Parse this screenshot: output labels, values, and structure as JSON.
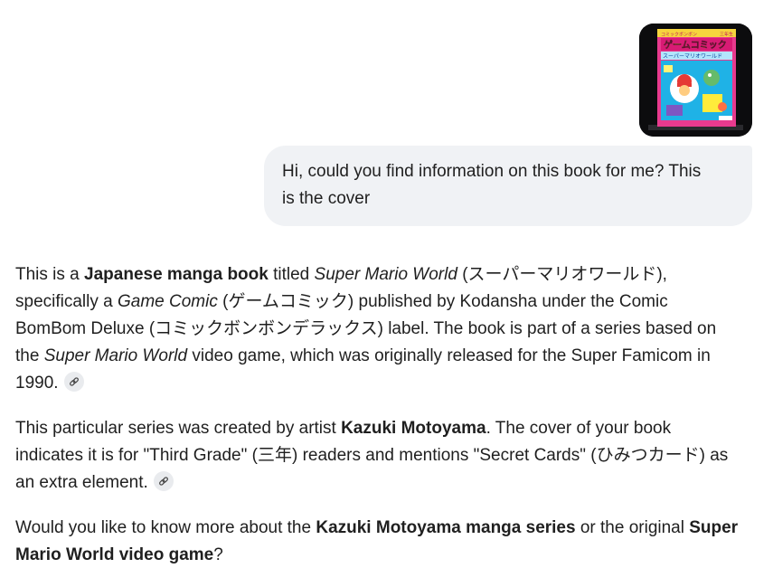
{
  "user_message": {
    "attachment_alt": "Book cover",
    "cover_text": {
      "series": "ゲームコミック",
      "subtitle": "スーパーマリオワールド",
      "top_small": "三年生",
      "label": "コミックボンボン"
    },
    "text_line1": "Hi, could you find information on this book for me? This",
    "text_line2": "is the cover"
  },
  "response": {
    "p1": {
      "t1": "This is a ",
      "b1": "Japanese manga book",
      "t2": " titled ",
      "i1": "Super Mario World",
      "t3": " (スーパーマリオワールド), specifically a ",
      "i2": "Game Comic",
      "t4": " (ゲームコミック) published by Kodansha under the Comic BomBom Deluxe (コミックボンボンデラックス) label. The book is part of a series based on the ",
      "i3": "Super Mario World",
      "t5": " video game, which was originally released for the Super Famicom in 1990."
    },
    "p2": {
      "t1": "This particular series was created by artist ",
      "b1": "Kazuki Motoyama",
      "t2": ". The cover of your book indicates it is for \"Third Grade\" (三年) readers and mentions \"Secret Cards\" (ひみつカード) as an extra element."
    },
    "p3": {
      "t1": "Would you like to know more about the ",
      "b1": "Kazuki Motoyama manga series",
      "t2": " or the original ",
      "b2": "Super Mario World video game",
      "t3": "?"
    }
  },
  "colors": {
    "bubble_bg": "#f0f2f5",
    "text": "#1f1f1f",
    "chip_bg": "#e9ebee",
    "cover_pink": "#e83a8e",
    "cover_blue": "#1fb2e6"
  },
  "icons": {
    "source_chip": "link-icon"
  }
}
